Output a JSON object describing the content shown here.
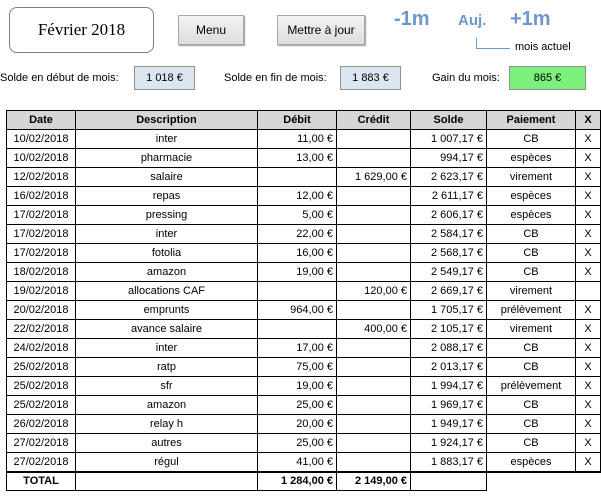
{
  "header": {
    "month_title": "Février 2018",
    "menu_label": "Menu",
    "update_label": "Mettre à jour",
    "prev_label": "-1m",
    "today_label": "Auj.",
    "next_label": "+1m",
    "current_month_note": "mois actuel"
  },
  "summary": {
    "start_label": "Solde en début de mois:",
    "start_value": "1 018 €",
    "end_label": "Solde en fin de mois:",
    "end_value": "1 883 €",
    "gain_label": "Gain du mois:",
    "gain_value": "865 €",
    "colors": {
      "value_box": "#dce6f1",
      "gain_box": "#7cf07c"
    }
  },
  "table": {
    "headers": [
      "Date",
      "Description",
      "Débit",
      "Crédit",
      "Solde",
      "Paiement",
      "X"
    ],
    "rows": [
      {
        "date": "10/02/2018",
        "desc": "inter",
        "debit": "11,00 €",
        "credit": "",
        "solde": "1 007,17 €",
        "pay": "CB",
        "x": "X"
      },
      {
        "date": "10/02/2018",
        "desc": "pharmacie",
        "debit": "13,00 €",
        "credit": "",
        "solde": "994,17 €",
        "pay": "espèces",
        "x": "X"
      },
      {
        "date": "12/02/2018",
        "desc": "salaire",
        "debit": "",
        "credit": "1 629,00 €",
        "solde": "2 623,17 €",
        "pay": "virement",
        "x": "X"
      },
      {
        "date": "16/02/2018",
        "desc": "repas",
        "debit": "12,00 €",
        "credit": "",
        "solde": "2 611,17 €",
        "pay": "espèces",
        "x": "X"
      },
      {
        "date": "17/02/2018",
        "desc": "pressing",
        "debit": "5,00 €",
        "credit": "",
        "solde": "2 606,17 €",
        "pay": "espèces",
        "x": "X"
      },
      {
        "date": "17/02/2018",
        "desc": "inter",
        "debit": "22,00 €",
        "credit": "",
        "solde": "2 584,17 €",
        "pay": "CB",
        "x": "X"
      },
      {
        "date": "17/02/2018",
        "desc": "fotolia",
        "debit": "16,00 €",
        "credit": "",
        "solde": "2 568,17 €",
        "pay": "CB",
        "x": "X"
      },
      {
        "date": "18/02/2018",
        "desc": "amazon",
        "debit": "19,00 €",
        "credit": "",
        "solde": "2 549,17 €",
        "pay": "CB",
        "x": "X"
      },
      {
        "date": "19/02/2018",
        "desc": "allocations CAF",
        "debit": "",
        "credit": "120,00 €",
        "solde": "2 669,17 €",
        "pay": "virement",
        "x": ""
      },
      {
        "date": "20/02/2018",
        "desc": "emprunts",
        "debit": "964,00 €",
        "credit": "",
        "solde": "1 705,17 €",
        "pay": "prélèvement",
        "x": "X"
      },
      {
        "date": "22/02/2018",
        "desc": "avance salaire",
        "debit": "",
        "credit": "400,00 €",
        "solde": "2 105,17 €",
        "pay": "virement",
        "x": "X"
      },
      {
        "date": "24/02/2018",
        "desc": "inter",
        "debit": "17,00 €",
        "credit": "",
        "solde": "2 088,17 €",
        "pay": "CB",
        "x": "X"
      },
      {
        "date": "25/02/2018",
        "desc": "ratp",
        "debit": "75,00 €",
        "credit": "",
        "solde": "2 013,17 €",
        "pay": "CB",
        "x": "X"
      },
      {
        "date": "25/02/2018",
        "desc": "sfr",
        "debit": "19,00 €",
        "credit": "",
        "solde": "1 994,17 €",
        "pay": "prélèvement",
        "x": "X"
      },
      {
        "date": "25/02/2018",
        "desc": "amazon",
        "debit": "25,00 €",
        "credit": "",
        "solde": "1 969,17 €",
        "pay": "CB",
        "x": "X"
      },
      {
        "date": "26/02/2018",
        "desc": "relay h",
        "debit": "20,00 €",
        "credit": "",
        "solde": "1 949,17 €",
        "pay": "CB",
        "x": "X"
      },
      {
        "date": "27/02/2018",
        "desc": "autres",
        "debit": "25,00 €",
        "credit": "",
        "solde": "1 924,17 €",
        "pay": "CB",
        "x": "X"
      },
      {
        "date": "27/02/2018",
        "desc": "régul",
        "debit": "41,00 €",
        "credit": "",
        "solde": "1 883,17 €",
        "pay": "espèces",
        "x": "X"
      }
    ],
    "total": {
      "label": "TOTAL",
      "debit": "1 284,00 €",
      "credit": "2 149,00 €"
    }
  }
}
